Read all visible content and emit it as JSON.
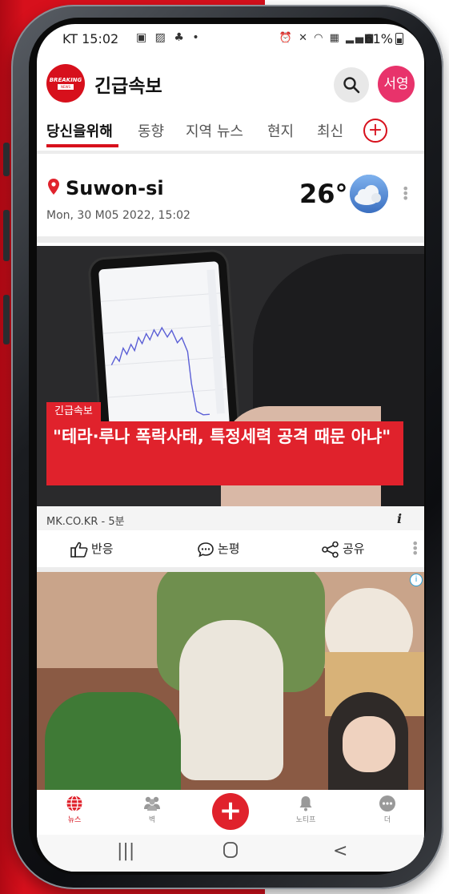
{
  "status_bar": {
    "carrier_time": "KT 15:02",
    "battery": "61%"
  },
  "app": {
    "title": "긴급속보",
    "logo_text": "BREAKING",
    "logo_subtext": "NEWS",
    "avatar_text": "서영"
  },
  "tabs": [
    {
      "label": "당신을위해"
    },
    {
      "label": "동향"
    },
    {
      "label": "지역 뉴스"
    },
    {
      "label": "현지"
    },
    {
      "label": "최신"
    }
  ],
  "weather": {
    "city": "Suwon-si",
    "date": "Mon, 30 M05 2022, 15:02",
    "temperature": "26°"
  },
  "article": {
    "tag": "긴급속보",
    "headline": "\"테라·루나 폭락사태, 특정세력 공격 때문 아냐\"",
    "source": "MK.CO.KR",
    "age": " - 5분",
    "actions": {
      "react": "반응",
      "comment": "논평",
      "share": "공유"
    }
  },
  "bottom_nav": [
    {
      "label": "뉴스",
      "icon": "globe-icon"
    },
    {
      "label": "벽",
      "icon": "people-icon"
    },
    {
      "label": "노티프",
      "icon": "bell-icon"
    },
    {
      "label": "더",
      "icon": "more-icon"
    }
  ],
  "colors": {
    "brand_red": "#d7101c",
    "avatar_pink": "#e8336b"
  }
}
